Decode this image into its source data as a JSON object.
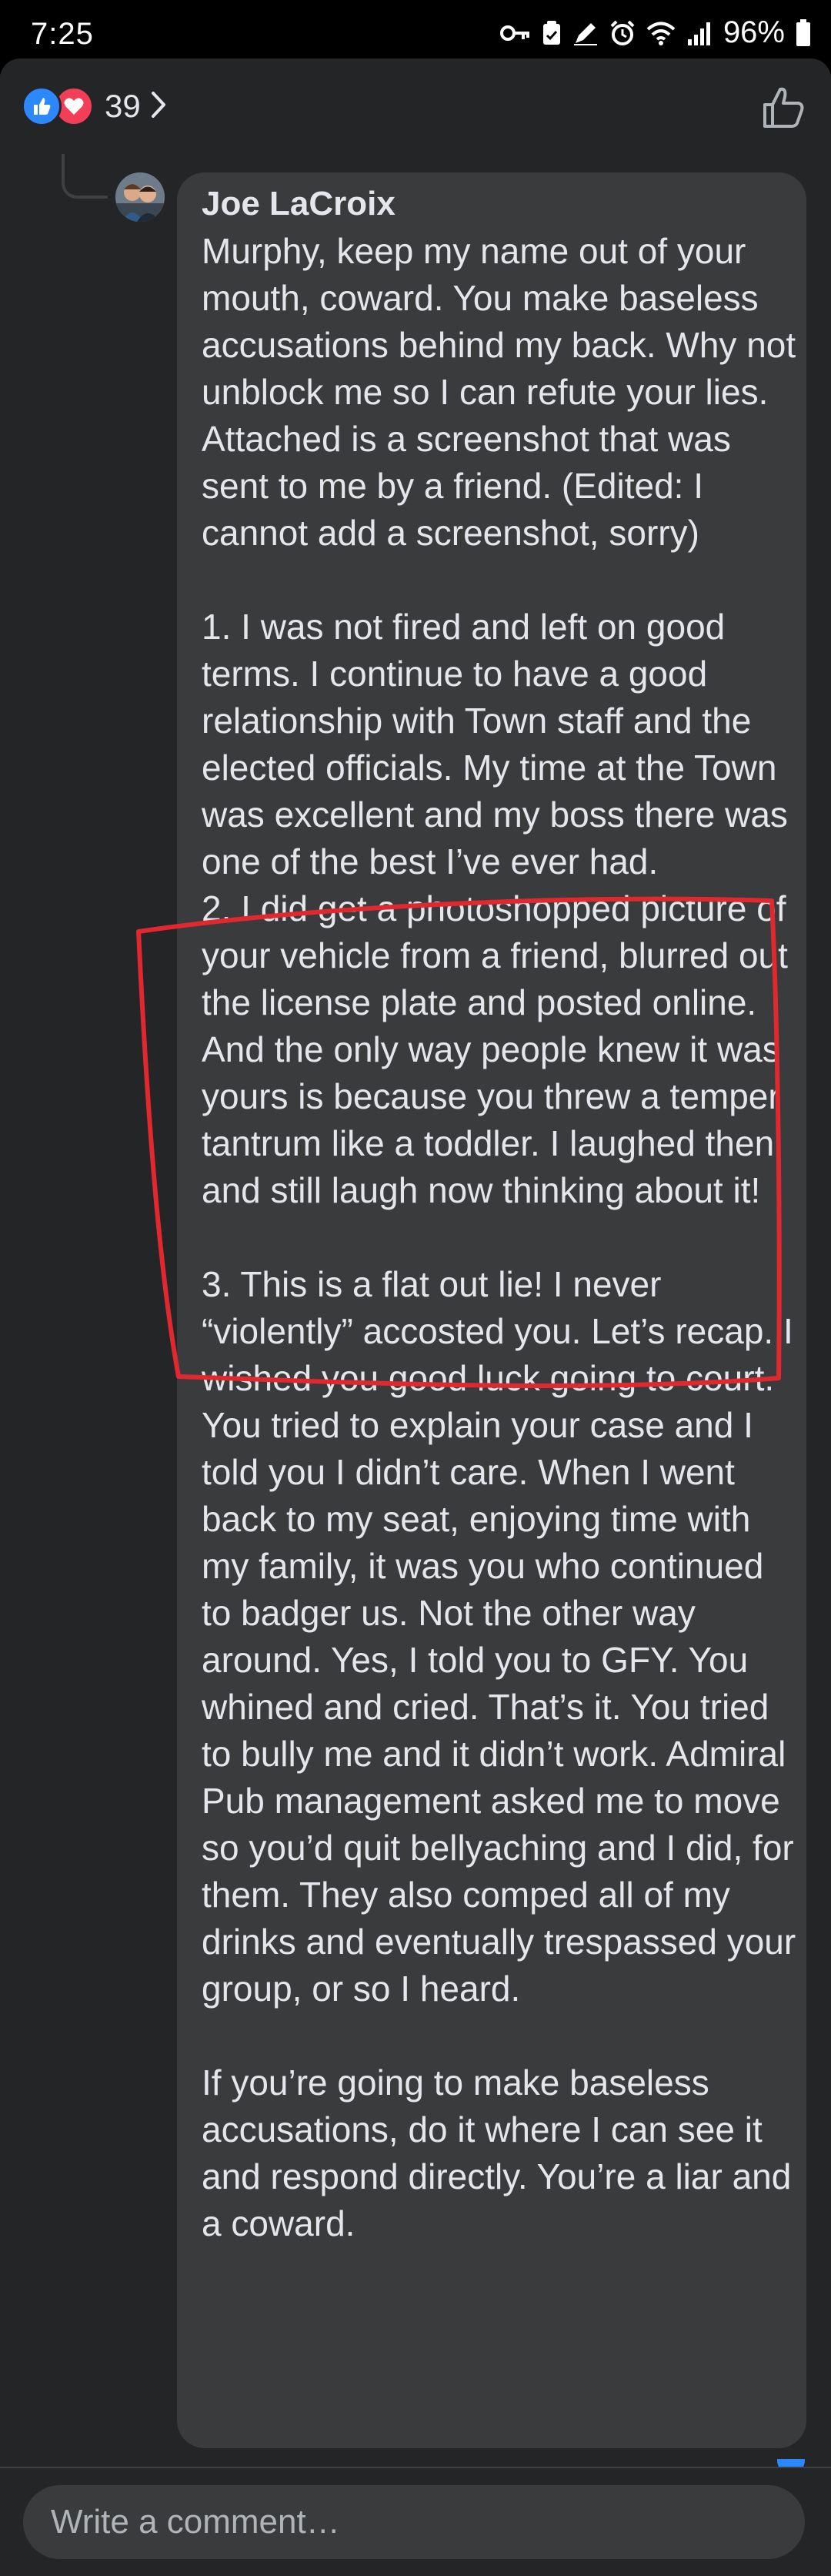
{
  "status_bar": {
    "time": "7:25",
    "battery": "96%"
  },
  "reactions": {
    "count": "39",
    "types": [
      "like-icon",
      "love-icon"
    ],
    "like_color": "#2d88ff",
    "love_color": "#f33e58"
  },
  "comment": {
    "author": "Joe LaCroix",
    "body": "Murphy, keep my name out of your mouth, coward. You make baseless accusations behind my back. Why not unblock me so I can refute your lies. Attached is a screenshot that was sent to me by a friend. (Edited: I cannot add a screenshot, sorry)\n\n1. I was not fired and left on good terms. I continue to have a good relationship with Town staff and the elected officials. My time at the Town was excellent and my boss there was one of the best I’ve ever had.\n2. I did get a photoshopped picture of your vehicle from a friend, blurred out the license plate and posted online. And the only way people knew it was yours is because you threw a temper tantrum like a toddler. I laughed then and still laugh now thinking about it!\n\n3. This is a flat out lie! I never “violently” accosted you. Let’s recap. I wished you good luck going to court. You tried to explain your case and I told you I didn’t care. When I went back to my seat, enjoying time with my family, it was you who continued to badger us. Not the other way around. Yes, I told you to GFY. You whined and cried. That’s it. You tried to bully me and it didn’t work. Admiral Pub management asked me to move so you’d quit bellyaching and I did, for them. They also comped all of my drinks and eventually trespassed your group, or so I heard.\n\nIf you’re going to make baseless accusations, do it where I can see it and respond directly. You’re a liar and a coward."
  },
  "annotation": {
    "color": "#e0282e"
  },
  "composer": {
    "placeholder": "Write a comment…"
  }
}
